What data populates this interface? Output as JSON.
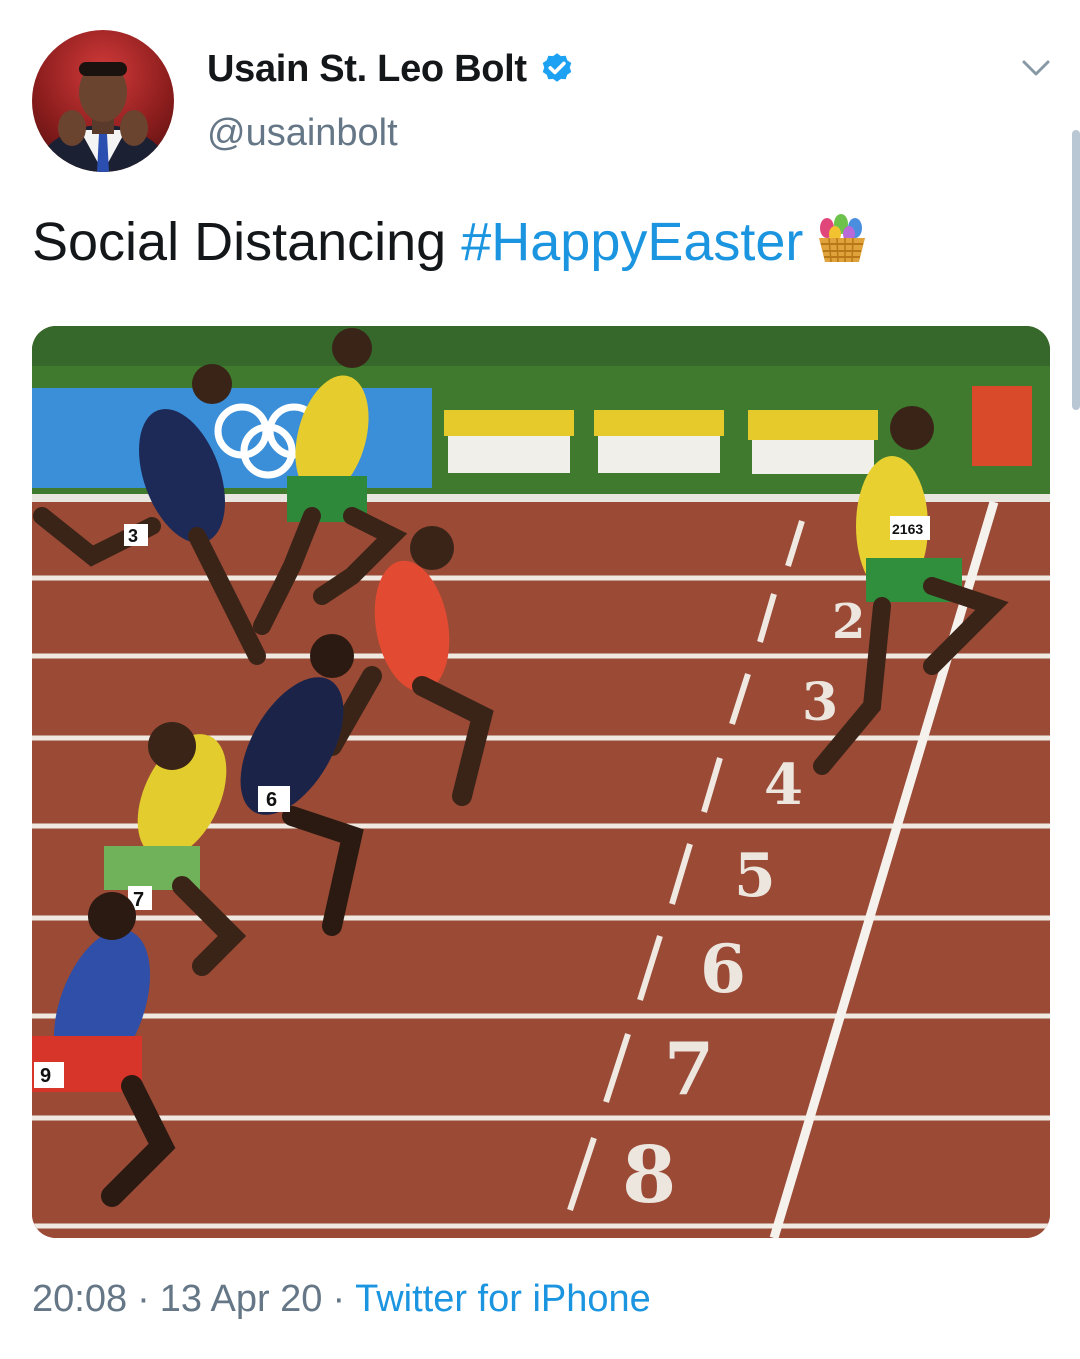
{
  "tweet": {
    "author": {
      "display_name": "Usain St. Leo Bolt",
      "handle": "@usainbolt",
      "verified": true
    },
    "text": {
      "plain": "Social Distancing ",
      "hashtag": "#HappyEaster",
      "emoji": "basket-icon"
    },
    "media": {
      "lane_numbers": [
        "2",
        "3",
        "4",
        "5",
        "6",
        "7",
        "8"
      ],
      "bib_numbers": [
        "3",
        "6",
        "7",
        "9",
        "2163"
      ]
    },
    "meta": {
      "time": "20:08",
      "separator": "·",
      "date": "13 Apr 20",
      "source": "Twitter for iPhone"
    }
  },
  "colors": {
    "link": "#1b95e0",
    "secondary_text": "#657786",
    "verified": "#1da1f2",
    "track": "#9a4a35"
  }
}
